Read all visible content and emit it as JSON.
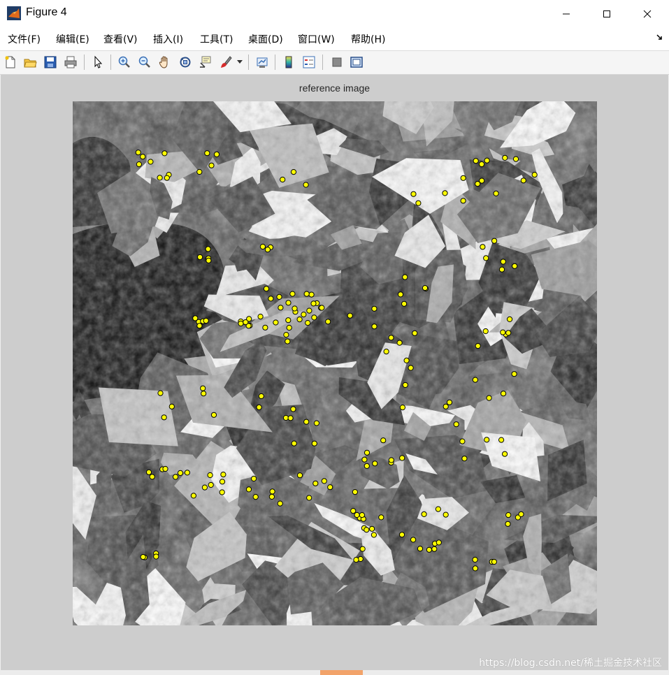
{
  "window": {
    "title": "Figure 4",
    "app_icon": "matlab-icon",
    "controls": [
      "minimize-icon",
      "maximize-icon",
      "close-icon"
    ]
  },
  "menu": {
    "items": [
      "文件(F)",
      "编辑(E)",
      "查看(V)",
      "插入(I)",
      "工具(T)",
      "桌面(D)",
      "窗口(W)",
      "帮助(H)"
    ],
    "dock_icon": "dock-arrow-icon"
  },
  "toolbar": {
    "buttons": [
      "new-figure-icon",
      "open-file-icon",
      "save-icon",
      "print-icon",
      "select-arrow-icon",
      "zoom-in-icon",
      "zoom-out-icon",
      "pan-hand-icon",
      "rotate-3d-icon",
      "data-cursor-icon",
      "brush-icon",
      "brush-dropdown-icon",
      "link-plot-icon",
      "colorbar-icon",
      "legend-icon",
      "hide-plot-tools-icon",
      "show-plot-tools-icon"
    ]
  },
  "axes": {
    "title": "reference image"
  },
  "colors": {
    "figure_bg": "#cdcdcd",
    "marker_fill": "#ffff00",
    "marker_edge": "#000000"
  },
  "footer": {
    "watermark": "https://blog.csdn.net/稀土掘金技术社区"
  }
}
